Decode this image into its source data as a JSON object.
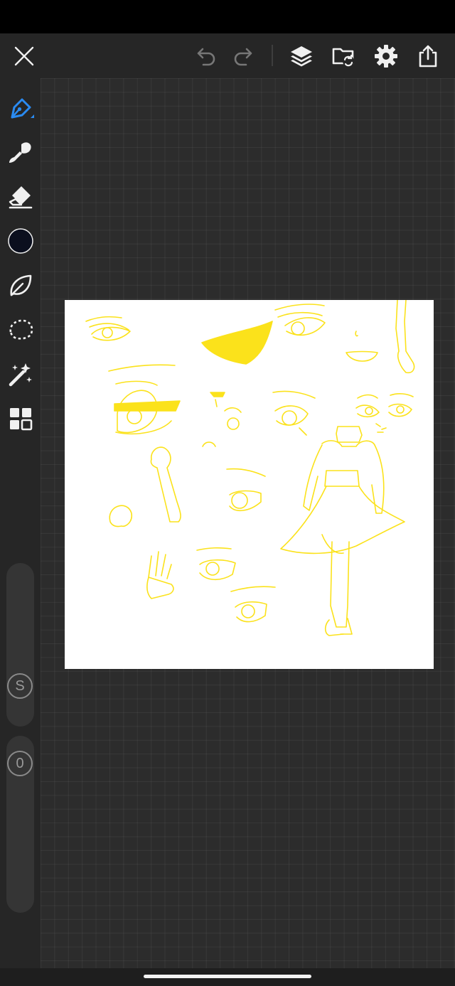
{
  "toolbar": {
    "actions": [
      "close",
      "undo",
      "redo",
      "layers",
      "gallery",
      "settings",
      "share"
    ]
  },
  "tools": [
    "pen",
    "brush",
    "eraser",
    "color",
    "lasso-fill",
    "lasso-select",
    "magic-wand",
    "more"
  ],
  "active_tool": "pen",
  "current_color": "#0b0f1e",
  "sliders": {
    "size_label": "S",
    "opacity_label": "0"
  },
  "sketch_color": "#fbe21b",
  "colors": {
    "accent": "#2a8bf2",
    "canvas": "#ffffff",
    "workspace": "#2c2c2c"
  }
}
